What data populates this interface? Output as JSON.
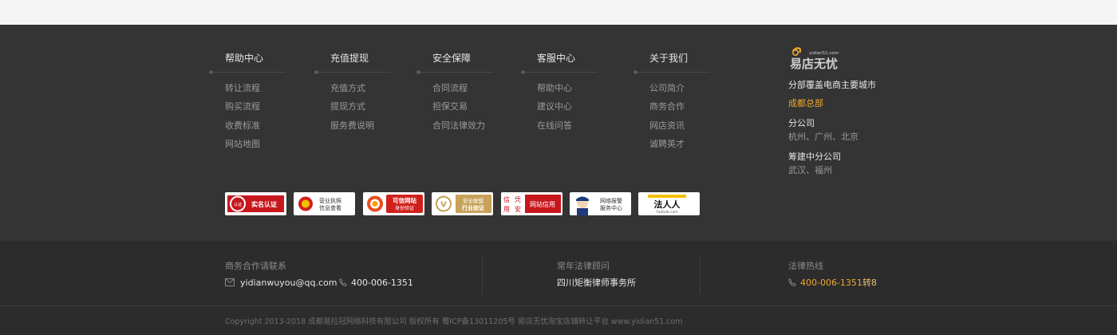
{
  "columns": [
    {
      "title": "帮助中心",
      "links": [
        "转让流程",
        "购买流程",
        "收费标准",
        "网站地图"
      ]
    },
    {
      "title": "充值提现",
      "links": [
        "充值方式",
        "提现方式",
        "服务费说明"
      ]
    },
    {
      "title": "安全保障",
      "links": [
        "合同流程",
        "担保交易",
        "合同法律效力"
      ]
    },
    {
      "title": "客服中心",
      "links": [
        "帮助中心",
        "建议中心",
        "在线问答"
      ]
    },
    {
      "title": "关于我们",
      "links": [
        "公司简介",
        "商务合作",
        "网店资讯",
        "诚聘英才"
      ]
    }
  ],
  "brand": {
    "logo_text": "易店无忧",
    "logo_small": "yidian51.com",
    "coverage": "分部覆盖电商主要城市",
    "hq": "成都总部",
    "branch_title": "分公司",
    "branch_cities": "杭州、广州、北京",
    "planned_title": "筹建中分公司",
    "planned_cities": "武汉、福州"
  },
  "badges": [
    {
      "text": "实名认证",
      "seal": "认证",
      "icon": "real-name-badge-icon"
    },
    {
      "text": "营业执照\n信息查看",
      "icon": "national-emblem-icon"
    },
    {
      "text": "可信网站\n身份验证",
      "icon": "trusted-site-icon"
    },
    {
      "text": "安全联盟\n行业验证",
      "icon": "security-alliance-icon"
    },
    {
      "text": "网站信用",
      "seal": "信凭用安",
      "icon": "credit-seal-icon"
    },
    {
      "text": "网络报警\n服务中心",
      "icon": "police-icon"
    },
    {
      "text": "法人人",
      "sub": "Fadada.com",
      "icon": "fadada-logo-icon"
    }
  ],
  "contact": {
    "business_label": "商务合作请联系",
    "email": "yidianwuyou@qq.com",
    "phone": "400-006-1351",
    "lawyer_label": "常年法律顾问",
    "lawyer_name": "四川矩衡律师事务所",
    "hotline_label": "法律热线",
    "hotline_number": "400-006-1351",
    "hotline_ext": "转8"
  },
  "copyright": "Copyright 2013-2018 成都易拉冠网络科技有限公司 版权所有 蜀ICP备13011205号 易店无忧淘宝店铺转让平台 www.yidian51.com",
  "colors": {
    "accent": "#f0a830",
    "footer_bg": "#343434",
    "footer_dark": "#2c2c2c"
  }
}
